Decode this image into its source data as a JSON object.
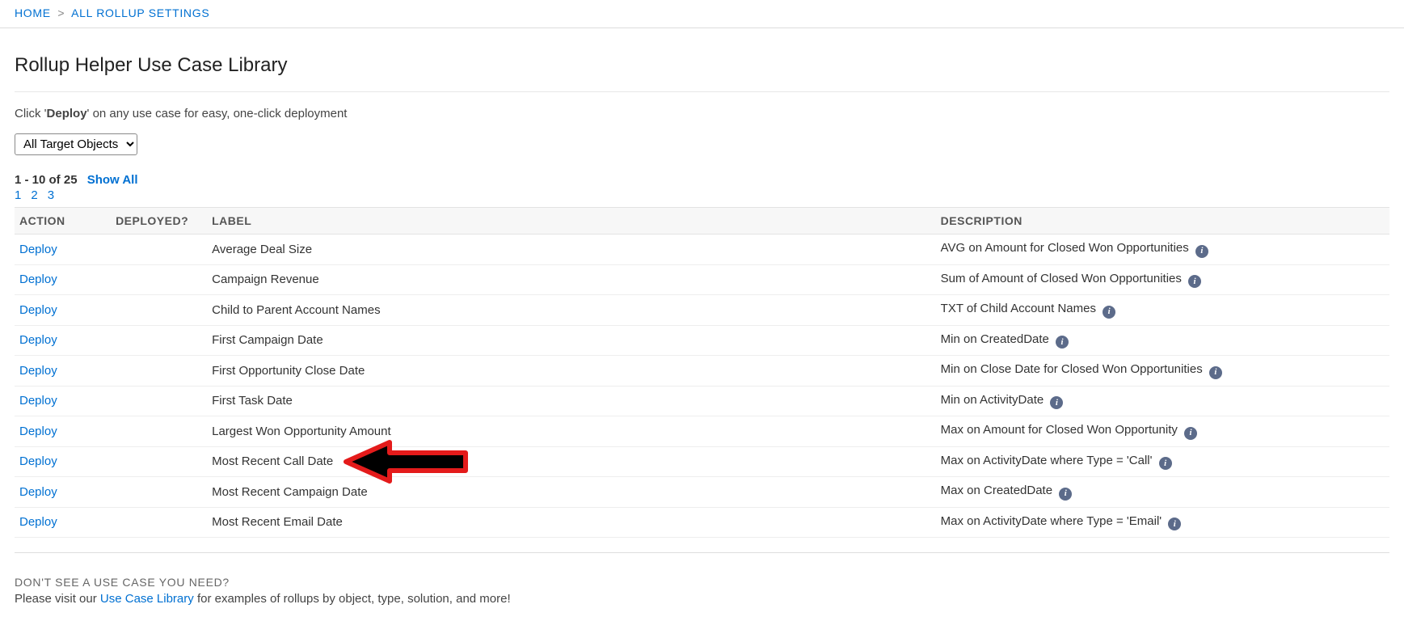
{
  "breadcrumb": {
    "home": "HOME",
    "separator": ">",
    "current": "ALL ROLLUP SETTINGS"
  },
  "page": {
    "title": "Rollup Helper Use Case Library",
    "helper_prefix": "Click '",
    "helper_bold": "Deploy",
    "helper_suffix": "' on any use case for easy, one-click deployment"
  },
  "filter": {
    "selected": "All Target Objects"
  },
  "pager": {
    "range": "1 - 10 of 25",
    "show_all": "Show All",
    "pages": [
      "1",
      "2",
      "3"
    ]
  },
  "table": {
    "headers": {
      "action": "ACTION",
      "deployed": "DEPLOYED?",
      "label": "LABEL",
      "description": "DESCRIPTION"
    },
    "action_label": "Deploy",
    "rows": [
      {
        "label": "Average Deal Size",
        "description": "AVG on Amount for Closed Won Opportunities"
      },
      {
        "label": "Campaign Revenue",
        "description": "Sum of Amount of Closed Won Opportunities"
      },
      {
        "label": "Child to Parent Account Names",
        "description": "TXT of Child Account Names"
      },
      {
        "label": "First Campaign Date",
        "description": "Min on CreatedDate"
      },
      {
        "label": "First Opportunity Close Date",
        "description": "Min on Close Date for Closed Won Opportunities"
      },
      {
        "label": "First Task Date",
        "description": "Min on ActivityDate"
      },
      {
        "label": "Largest Won Opportunity Amount",
        "description": "Max on Amount for Closed Won Opportunity"
      },
      {
        "label": "Most Recent Call Date",
        "description": "Max on ActivityDate where Type =  'Call'"
      },
      {
        "label": "Most Recent Campaign Date",
        "description": "Max on CreatedDate"
      },
      {
        "label": "Most Recent Email Date",
        "description": "Max on ActivityDate where Type =  'Email'"
      }
    ]
  },
  "footer": {
    "heading": "DON'T SEE A USE CASE YOU NEED?",
    "text_before": "Please visit our ",
    "link": "Use Case Library",
    "text_after": " for examples of rollups by object, type, solution, and more!"
  },
  "annotation": {
    "highlight_row_index": 7
  }
}
